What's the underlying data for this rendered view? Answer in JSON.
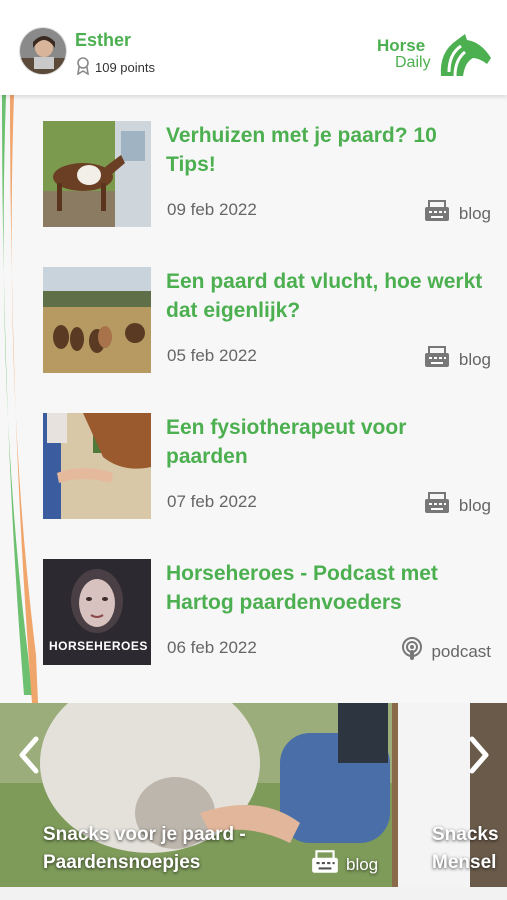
{
  "user": {
    "name": "Esther",
    "points": "109 points"
  },
  "logo": {
    "line1": "Horse",
    "line2": "Daily"
  },
  "colors": {
    "accent": "#4caf50",
    "ribbon_orange": "#f0a56b",
    "ribbon_green": "#6cc06f"
  },
  "articles": [
    {
      "title": "Verhuizen met je paard? 10 Tips!",
      "date": "09 feb 2022",
      "type": "blog",
      "icon": "typewriter-icon"
    },
    {
      "title": "Een paard dat vlucht, hoe werkt dat eigenlijk?",
      "date": "05 feb 2022",
      "type": "blog",
      "icon": "typewriter-icon"
    },
    {
      "title": "Een fysiotherapeut voor paarden",
      "date": "07 feb 2022",
      "type": "blog",
      "icon": "typewriter-icon"
    },
    {
      "title": "Horseheroes - Podcast met Hartog paardenvoeders",
      "date": "06 feb 2022",
      "type": "podcast",
      "icon": "podcast-icon",
      "thumb_text": "HORSEHEROES"
    }
  ],
  "carousel": {
    "current": {
      "title_line1": "Snacks voor je paard -",
      "title_line2": "Paardensnoepjes",
      "type": "blog"
    },
    "next": {
      "title_line1": "Snacks",
      "title_line2": "Mensel"
    }
  }
}
